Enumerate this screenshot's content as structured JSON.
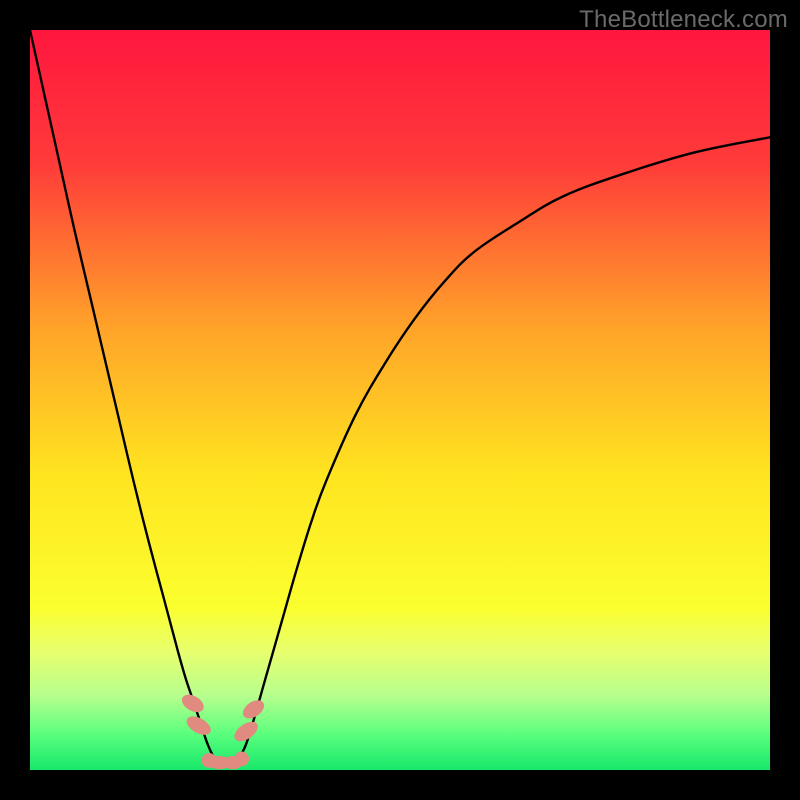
{
  "watermark": "TheBottleneck.com",
  "chart_data": {
    "type": "line",
    "title": "",
    "xlabel": "",
    "ylabel": "",
    "xlim": [
      0,
      100
    ],
    "ylim": [
      0,
      100
    ],
    "grid": false,
    "legend": false,
    "gradient_stops": [
      {
        "offset": 0,
        "color": "#ff163e"
      },
      {
        "offset": 18,
        "color": "#ff3b3a"
      },
      {
        "offset": 40,
        "color": "#ffa229"
      },
      {
        "offset": 60,
        "color": "#ffe420"
      },
      {
        "offset": 78,
        "color": "#fbff2e"
      },
      {
        "offset": 84,
        "color": "#e8ff6e"
      },
      {
        "offset": 90,
        "color": "#b6ff8e"
      },
      {
        "offset": 95,
        "color": "#5dff7e"
      },
      {
        "offset": 100,
        "color": "#17e86b"
      }
    ],
    "series": [
      {
        "name": "curve",
        "x": [
          0,
          2,
          4,
          6,
          8,
          10,
          12,
          14,
          16,
          18,
          20,
          21,
          22,
          23,
          24,
          25,
          26,
          27,
          28,
          29,
          30,
          32,
          34,
          36,
          38,
          40,
          44,
          48,
          52,
          56,
          60,
          66,
          72,
          80,
          90,
          100
        ],
        "values": [
          100,
          91,
          82,
          73,
          64.5,
          56,
          47.5,
          39,
          31,
          23.5,
          16,
          12.5,
          9.5,
          6.5,
          3.5,
          1.5,
          1.0,
          1.0,
          1.5,
          3.0,
          6.0,
          13,
          20,
          27,
          33.5,
          39,
          48,
          55,
          61,
          66,
          70,
          74,
          77.5,
          80.5,
          83.5,
          85.5
        ]
      }
    ],
    "markers": [
      {
        "shape": "round",
        "cx": 22.0,
        "cy": 9.0,
        "rx": 1.0,
        "ry": 1.6,
        "rotate": -60
      },
      {
        "shape": "round",
        "cx": 22.8,
        "cy": 6.0,
        "rx": 1.0,
        "ry": 1.8,
        "rotate": -60
      },
      {
        "shape": "round",
        "cx": 29.2,
        "cy": 5.2,
        "rx": 1.0,
        "ry": 1.8,
        "rotate": 55
      },
      {
        "shape": "round",
        "cx": 30.2,
        "cy": 8.2,
        "rx": 1.0,
        "ry": 1.6,
        "rotate": 55
      },
      {
        "shape": "round",
        "cx": 24.2,
        "cy": 1.3,
        "rx": 1.0,
        "ry": 1.0,
        "rotate": 0
      },
      {
        "shape": "round",
        "cx": 25.6,
        "cy": 1.0,
        "rx": 1.6,
        "ry": 0.9,
        "rotate": 0
      },
      {
        "shape": "round",
        "cx": 27.4,
        "cy": 1.0,
        "rx": 1.3,
        "ry": 0.9,
        "rotate": 0
      },
      {
        "shape": "round",
        "cx": 28.6,
        "cy": 1.5,
        "rx": 1.0,
        "ry": 1.0,
        "rotate": 0
      }
    ],
    "marker_fill": "#e08a80",
    "curve_stroke": "#000000",
    "curve_width": 2.4
  }
}
